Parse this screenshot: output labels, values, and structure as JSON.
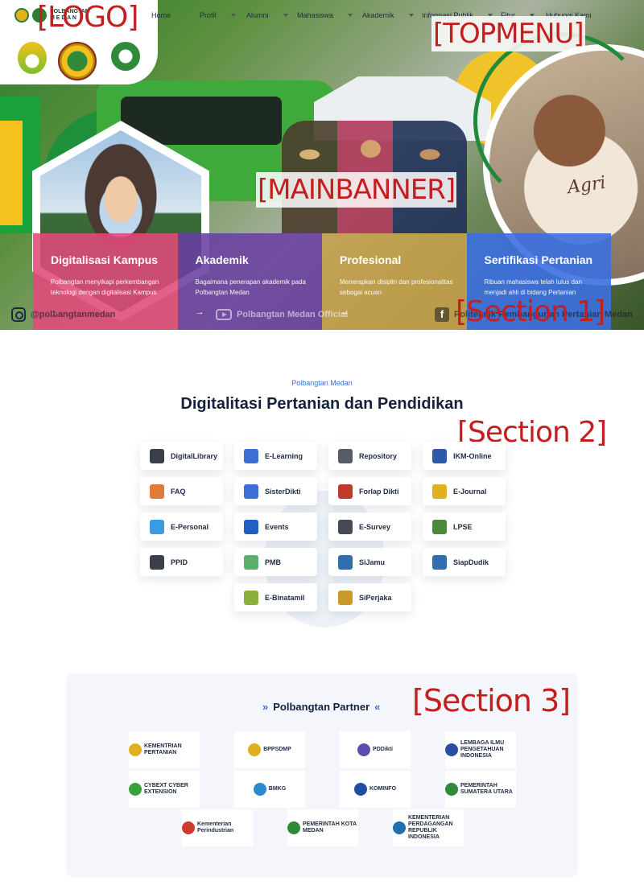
{
  "logo": {
    "name_line1": "POLBANGTAN",
    "name_line2": "M E D A N"
  },
  "topnav": [
    {
      "label": "Home",
      "dropdown": false
    },
    {
      "label": "Profil",
      "dropdown": true
    },
    {
      "label": "Alumni",
      "dropdown": true
    },
    {
      "label": "Mahasiswa",
      "dropdown": true
    },
    {
      "label": "Akademik",
      "dropdown": true
    },
    {
      "label": "Informasi Publik",
      "dropdown": true
    },
    {
      "label": "Fitur",
      "dropdown": true
    },
    {
      "label": "Hubungi Kami",
      "dropdown": false
    }
  ],
  "annotations": {
    "logo": "[LOGO]",
    "topmenu": "[TOPMENU]",
    "mainbanner": "[MAINBANNER]",
    "section1": "[Section 1]",
    "section2": "[Section 2]",
    "section3": "[Section 3]"
  },
  "banner": {
    "cup_text": "Agri"
  },
  "cards": [
    {
      "title": "Digitalisasi Kampus",
      "desc": "Polbangtan menyikapi perkembangan teknologi dengan digitalisasi Kampus",
      "arrow": "→",
      "color": "#e04a7a"
    },
    {
      "title": "Akademik",
      "desc": "Bagaimana penerapan akademik pada Polbangtan Medan",
      "arrow": "→",
      "color": "#6a3fa0"
    },
    {
      "title": "Profesional",
      "desc": "Menerapkan disiplin dan profesionalitas sebagai acuan",
      "arrow": "→",
      "color": "#c9a14a"
    },
    {
      "title": "Sertifikasi Pertanian",
      "desc": "Ribuan mahasiswa telah lulus dan menjadi ahli di bidang Pertanian",
      "arrow": "→",
      "color": "#3b6fe0"
    }
  ],
  "social": {
    "instagram": "@polbangtanmedan",
    "youtube": "Polbangtan Medan Official",
    "facebook": "Politeknik Pembangunan Pertanian Medan"
  },
  "section2": {
    "subtitle": "Polbangtan Medan",
    "title": "Digitalitasi Pertanian dan Pendidikan",
    "services": [
      {
        "label": "DigitalLibrary",
        "icon": "books-icon",
        "color": "#3a3f4a"
      },
      {
        "label": "E-Learning",
        "icon": "laptop-icon",
        "color": "#3b6fd6"
      },
      {
        "label": "Repository",
        "icon": "folder-icon",
        "color": "#555c66"
      },
      {
        "label": "IKM-Online",
        "icon": "monitor-icon",
        "color": "#2f5aa8"
      },
      {
        "label": "FAQ",
        "icon": "faq-icon",
        "color": "#e07a3a"
      },
      {
        "label": "SisterDikti",
        "icon": "sister-icon",
        "color": "#3b6fd6"
      },
      {
        "label": "Forlap Dikti",
        "icon": "building-icon",
        "color": "#c0392b"
      },
      {
        "label": "E-Journal",
        "icon": "journal-icon",
        "color": "#e0b020"
      },
      {
        "label": "E-Personal",
        "icon": "person-icon",
        "color": "#3b9be0"
      },
      {
        "label": "Events",
        "icon": "calendar-icon",
        "color": "#1f5fc4"
      },
      {
        "label": "E-Survey",
        "icon": "survey-icon",
        "color": "#444b55"
      },
      {
        "label": "LPSE",
        "icon": "lpse-icon",
        "color": "#4a8a3a"
      },
      {
        "label": "PPID",
        "icon": "ppid-icon",
        "color": "#3a3f4a"
      },
      {
        "label": "PMB",
        "icon": "chart-icon",
        "color": "#5ab06a"
      },
      {
        "label": "SiJamu",
        "icon": "sijamu-icon",
        "color": "#2f6fb0"
      },
      {
        "label": "SiapDudik",
        "icon": "siapdudik-icon",
        "color": "#2f6fb0"
      },
      {
        "label": "E-Binatamil",
        "icon": "folder-green-icon",
        "color": "#8ab03a"
      },
      {
        "label": "SiPerjaka",
        "icon": "document-icon",
        "color": "#c99a2a"
      }
    ]
  },
  "section3": {
    "title": "Polbangtan Partner",
    "chevron_left": "»",
    "chevron_right": "«",
    "partners": [
      {
        "label": "KEMENTRIAN PERTANIAN",
        "color": "#e0b020"
      },
      {
        "label": "BPPSDMP",
        "color": "#e0b020"
      },
      {
        "label": "PDDikti",
        "color": "#5a4fb0"
      },
      {
        "label": "LEMBAGA ILMU PENGETAHUAN INDONESIA",
        "color": "#2a4fa0"
      },
      {
        "label": "CYBEXT CYBER EXTENSION",
        "color": "#3aa03a"
      },
      {
        "label": "BMKG",
        "color": "#2a8ad0"
      },
      {
        "label": "KOMINFO",
        "color": "#1f4fa0"
      },
      {
        "label": "PEMERINTAH SUMATERA UTARA",
        "color": "#2f8a3a"
      },
      {
        "label": "Kementerian Perindustrian",
        "color": "#d03a2a"
      },
      {
        "label": "PEMERINTAH KOTA MEDAN",
        "color": "#2f8a3a"
      },
      {
        "label": "KEMENTERIAN PERDAGANGAN REPUBLIK INDONESIA",
        "color": "#1f6fb0"
      }
    ]
  }
}
